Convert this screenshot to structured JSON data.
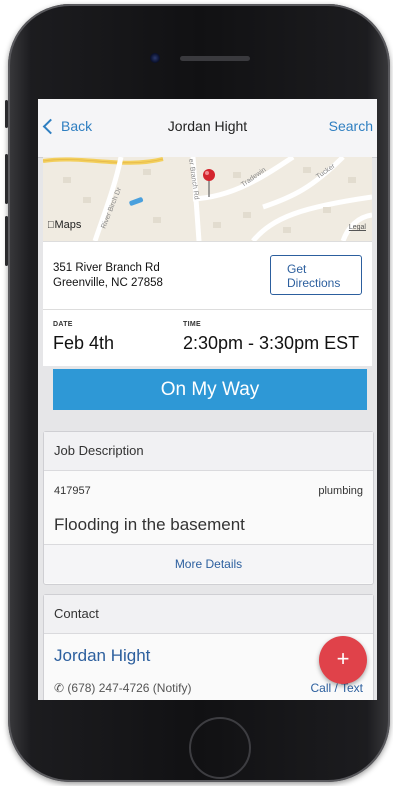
{
  "navbar": {
    "back_label": "Back",
    "title": "Jordan Hight",
    "search_label": "Search"
  },
  "map": {
    "street_labels": [
      "River Birch Dr",
      "er Branch Rd",
      "Tradewin",
      "Tucker"
    ],
    "maps_label": "Maps",
    "legal_label": "Legal"
  },
  "address": {
    "line1": "351 River Branch Rd",
    "line2": "Greenville, NC 27858",
    "directions_line1": "Get",
    "directions_line2": "Directions"
  },
  "schedule": {
    "date_label": "DATE",
    "date_value": "Feb 4th",
    "time_label": "TIME",
    "time_value": "2:30pm - 3:30pm EST"
  },
  "on_my_way_label": "On My Way",
  "job": {
    "header": "Job Description",
    "number": "417957",
    "type": "plumbing",
    "description": "Flooding in the basement",
    "more_label": "More Details"
  },
  "contact": {
    "header": "Contact",
    "name": "Jordan Hight",
    "phone": "(678) 247-4726 (Notify)",
    "call_label": "Call",
    "separator": "/",
    "text_label": "Text"
  },
  "fab_label": "+",
  "colors": {
    "accent": "#2e98d6",
    "link": "#2c5f9e",
    "fab": "#e0424a"
  }
}
